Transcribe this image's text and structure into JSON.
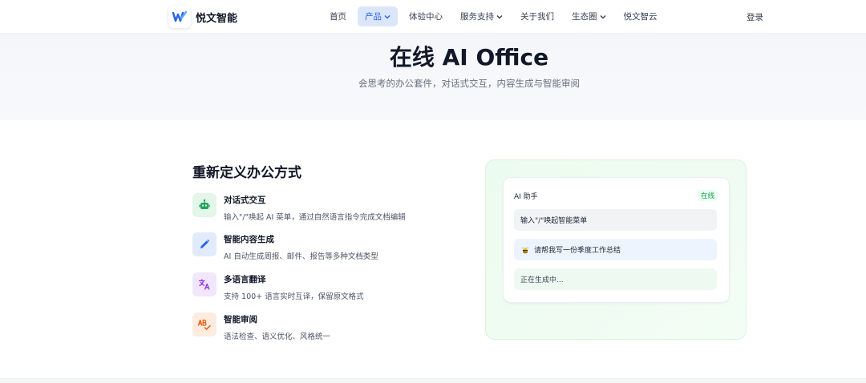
{
  "brand": {
    "name": "悦文智能"
  },
  "nav": {
    "items": [
      {
        "label": "首页",
        "dropdown": false,
        "active": false
      },
      {
        "label": "产品",
        "dropdown": true,
        "active": true
      },
      {
        "label": "体验中心",
        "dropdown": false,
        "active": false
      },
      {
        "label": "服务支持",
        "dropdown": true,
        "active": false
      },
      {
        "label": "关于我们",
        "dropdown": false,
        "active": false
      },
      {
        "label": "生态圈",
        "dropdown": true,
        "active": false
      },
      {
        "label": "悦文智云",
        "dropdown": false,
        "active": false
      }
    ],
    "login": "登录"
  },
  "hero": {
    "title": "在线 AI Office",
    "subtitle": "会思考的办公套件，对话式交互，内容生成与智能审阅"
  },
  "features": {
    "title": "重新定义办公方式",
    "items": [
      {
        "icon": "robot-icon",
        "title": "对话式交互",
        "desc": "输入\"/\"唤起 AI 菜单，通过自然语言指令完成文档编辑"
      },
      {
        "icon": "pen-icon",
        "title": "智能内容生成",
        "desc": "AI 自动生成周报、邮件、报告等多种文档类型"
      },
      {
        "icon": "translate-icon",
        "title": "多语言翻译",
        "desc": "支持 100+ 语言实时互译，保留原文格式"
      },
      {
        "icon": "spellcheck-icon",
        "title": "智能审阅",
        "desc": "语法检查、语义优化、风格统一"
      }
    ]
  },
  "assistant": {
    "title": "AI 助手",
    "status": "在线",
    "messages": [
      {
        "text": "输入\"/\"唤起智能菜单"
      },
      {
        "icon": "bee-icon",
        "text": "请帮我写一份季度工作总结"
      },
      {
        "text": "正在生成中..."
      }
    ]
  },
  "colors": {
    "accent": "#2563eb",
    "online": "#16a34a",
    "robot": "#22a55a",
    "pen": "#2563eb",
    "translate": "#9333ea",
    "spellcheck": "#ea580c"
  }
}
